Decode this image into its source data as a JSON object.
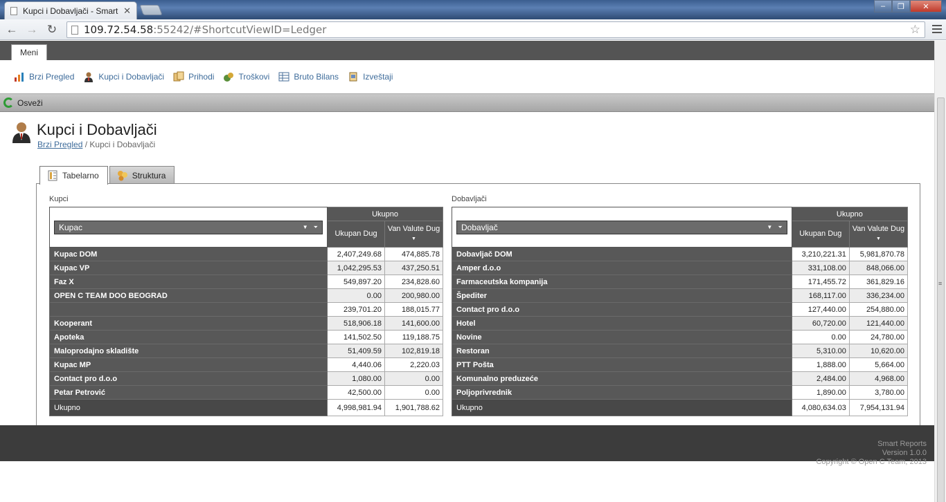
{
  "browser": {
    "tab_title": "Kupci i Dobavljači - Smart",
    "url_host": "109.72.54.58",
    "url_path": ":55242/#ShortcutViewID=Ledger"
  },
  "menu": {
    "tab_label": "Meni",
    "items": [
      {
        "label": "Brzi Pregled",
        "icon": "chart-icon"
      },
      {
        "label": "Kupci i Dobavljači",
        "icon": "person-icon"
      },
      {
        "label": "Prihodi",
        "icon": "folders-icon"
      },
      {
        "label": "Troškovi",
        "icon": "money-icon"
      },
      {
        "label": "Bruto Bilans",
        "icon": "table-icon"
      },
      {
        "label": "Izveštaji",
        "icon": "report-icon"
      }
    ]
  },
  "actions": {
    "refresh_label": "Osveži"
  },
  "page": {
    "title": "Kupci i Dobavljači",
    "breadcrumb_link": "Brzi Pregled",
    "breadcrumb_sep": "/",
    "breadcrumb_current": "Kupci i Dobavljači"
  },
  "view_tabs": {
    "table": "Tabelarno",
    "structure": "Struktura"
  },
  "kupci": {
    "label": "Kupci",
    "filter": "Kupac",
    "group_header": "Ukupno",
    "col1": "Ukupan Dug",
    "col2": "Van Valute Dug",
    "rows": [
      [
        "Kupac DOM",
        "2,407,249.68",
        "474,885.78"
      ],
      [
        "Kupac VP",
        "1,042,295.53",
        "437,250.51"
      ],
      [
        "Faz X",
        "549,897.20",
        "234,828.60"
      ],
      [
        "OPEN C TEAM DOO BEOGRAD",
        "0.00",
        "200,980.00"
      ],
      [
        "",
        "239,701.20",
        "188,015.77"
      ],
      [
        "Kooperant",
        "518,906.18",
        "141,600.00"
      ],
      [
        "Apoteka",
        "141,502.50",
        "119,188.75"
      ],
      [
        "Maloprodajno skladište",
        "51,409.59",
        "102,819.18"
      ],
      [
        "Kupac MP",
        "4,440.06",
        "2,220.03"
      ],
      [
        "Contact pro d.o.o",
        "1,080.00",
        "0.00"
      ],
      [
        "Petar Petrović",
        "42,500.00",
        "0.00"
      ]
    ],
    "total_label": "Ukupno",
    "total": [
      "4,998,981.94",
      "1,901,788.62"
    ]
  },
  "dobavljaci": {
    "label": "Dobavljači",
    "filter": "Dobavljač",
    "group_header": "Ukupno",
    "col1": "Ukupan Dug",
    "col2": "Van Valute Dug",
    "rows": [
      [
        "Dobavljač DOM",
        "3,210,221.31",
        "5,981,870.78"
      ],
      [
        "Amper d.o.o",
        "331,108.00",
        "848,066.00"
      ],
      [
        "Farmaceutska kompanija",
        "171,455.72",
        "361,829.16"
      ],
      [
        "Špediter",
        "168,117.00",
        "336,234.00"
      ],
      [
        "Contact pro d.o.o",
        "127,440.00",
        "254,880.00"
      ],
      [
        "Hotel",
        "60,720.00",
        "121,440.00"
      ],
      [
        "Novine",
        "0.00",
        "24,780.00"
      ],
      [
        "Restoran",
        "5,310.00",
        "10,620.00"
      ],
      [
        "PTT Pošta",
        "1,888.00",
        "5,664.00"
      ],
      [
        "Komunalno preduzeće",
        "2,484.00",
        "4,968.00"
      ],
      [
        "Poljoprivrednik",
        "1,890.00",
        "3,780.00"
      ]
    ],
    "total_label": "Ukupno",
    "total": [
      "4,080,634.03",
      "7,954,131.94"
    ]
  },
  "footer": {
    "line1": "Smart Reports",
    "line2": "Version 1.0.0",
    "line3": "Copyright © Open C Team, 2013"
  }
}
